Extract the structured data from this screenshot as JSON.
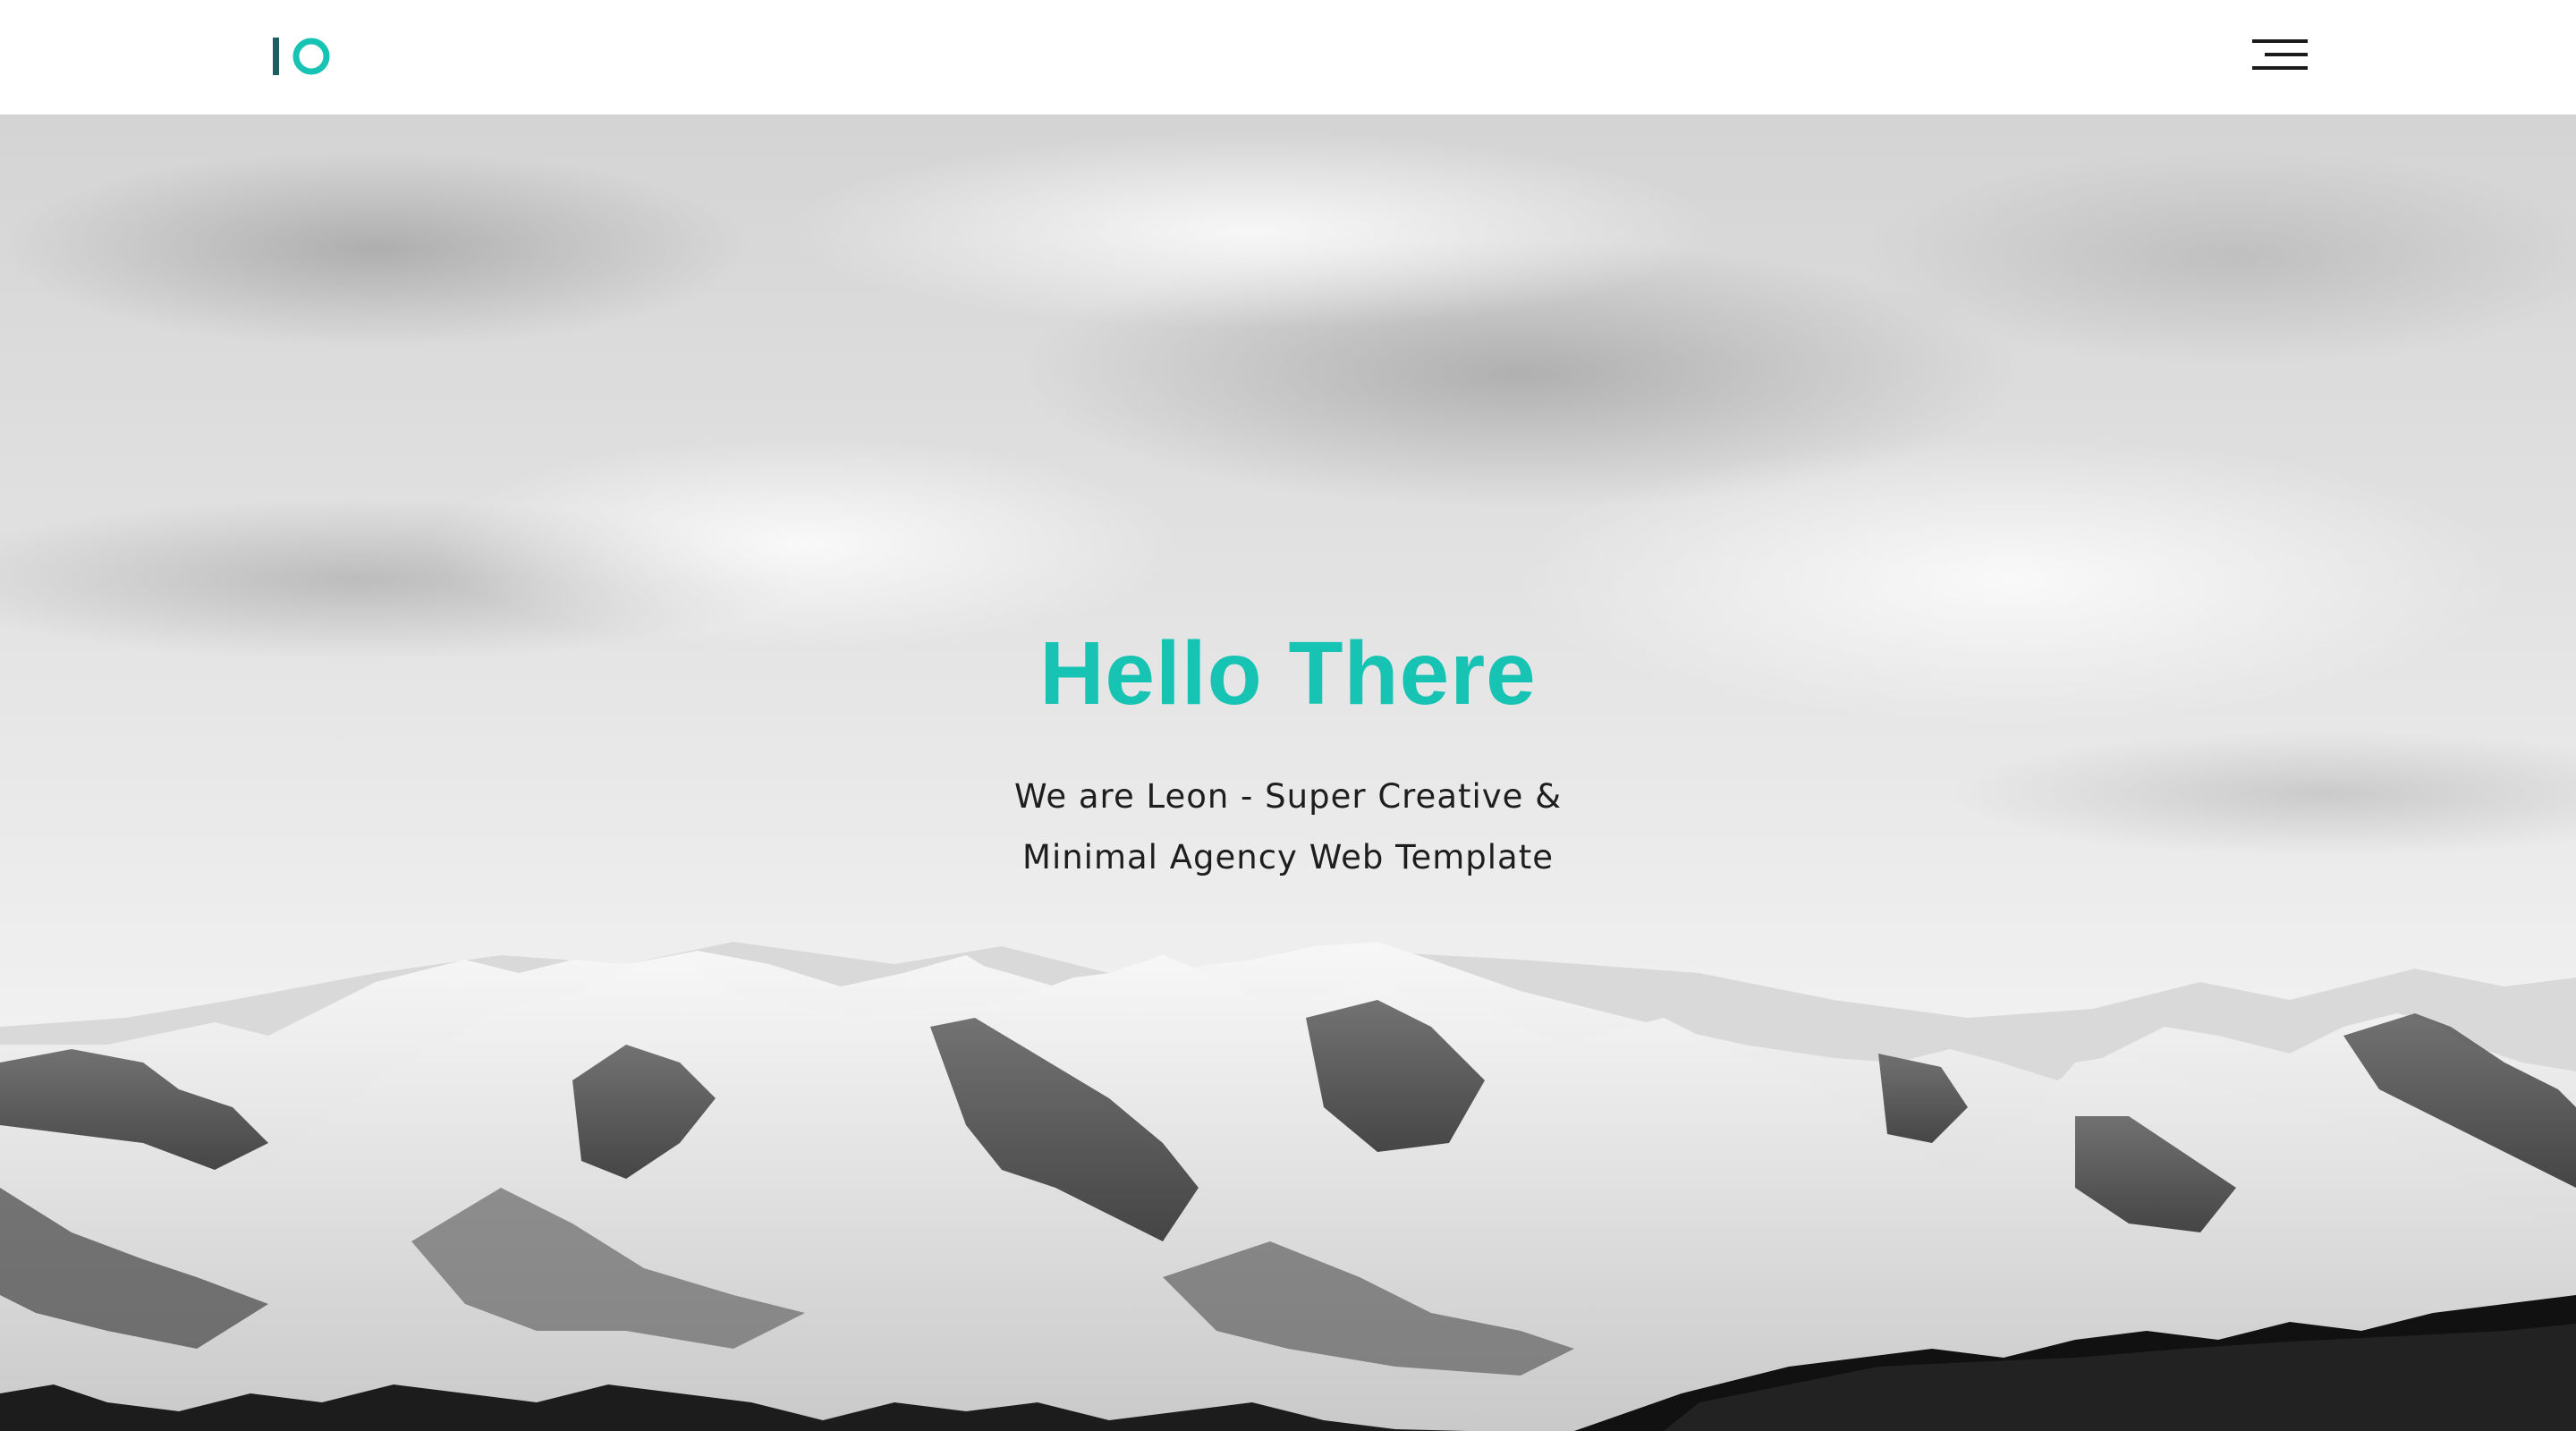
{
  "brand": {
    "logo_text": "IO",
    "colors": {
      "accent": "#17c3b2",
      "logo_bar": "#1e5e63",
      "menu_lines": "#1a1a1a",
      "header_bg": "#ffffff"
    }
  },
  "header": {
    "menu_icon": "hamburger-menu-icon"
  },
  "hero": {
    "title": "Hello There",
    "subtitle_line1": "We are Leon - Super Creative &",
    "subtitle_line2": "Minimal Agency Web Template",
    "background": "black-and-white snowy mountain range under cloudy sky"
  }
}
